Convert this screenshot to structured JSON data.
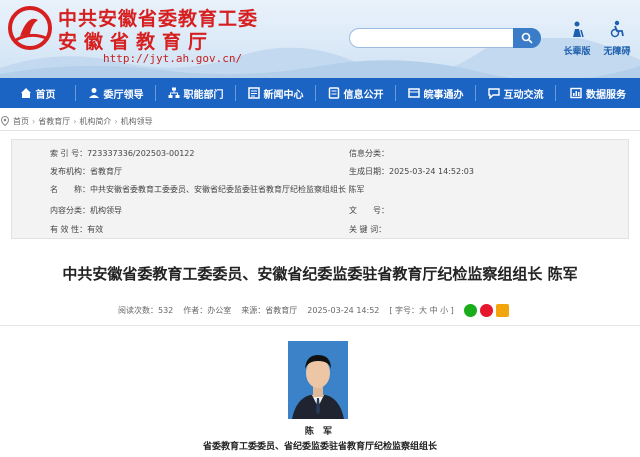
{
  "header": {
    "title_line1": "中共安徽省委教育工委",
    "title_line2": "安徽省教育厅",
    "url": "http://jyt.ah.gov.cn/",
    "search_placeholder": "",
    "tools": [
      {
        "label": "长辈版",
        "icon": "elder-icon"
      },
      {
        "label": "无障碍",
        "icon": "accessibility-icon"
      }
    ]
  },
  "nav": {
    "items": [
      {
        "label": "首页",
        "icon": "home-icon"
      },
      {
        "label": "委厅领导",
        "icon": "leader-icon"
      },
      {
        "label": "职能部门",
        "icon": "org-icon"
      },
      {
        "label": "新闻中心",
        "icon": "news-icon"
      },
      {
        "label": "信息公开",
        "icon": "info-icon"
      },
      {
        "label": "皖事通办",
        "icon": "service-icon"
      },
      {
        "label": "互动交流",
        "icon": "chat-icon"
      },
      {
        "label": "数据服务",
        "icon": "data-icon"
      }
    ]
  },
  "breadcrumb": [
    "首页",
    "省教育厅",
    "机构简介",
    "机构领导"
  ],
  "meta": {
    "index_label": "索 引 号：",
    "index_value": "723337336/202503-00122",
    "category_label": "信息分类：",
    "category_value": "",
    "publisher_label": "发布机构：",
    "publisher_value": "省教育厅",
    "date_label": "生成日期：",
    "date_value": "2025-03-24 14:52:03",
    "name_label": "名　　称：",
    "name_value": "中共安徽省委教育工委委员、安徽省纪委监委驻省教育厅纪检监察组组长 陈军",
    "content_label": "内容分类：",
    "content_value": "机构领导",
    "docno_label": "文　　号：",
    "docno_value": "",
    "validity_label": "有 效 性：",
    "validity_value": "有效",
    "keyword_label": "关 键 词：",
    "keyword_value": ""
  },
  "article": {
    "title": "中共安徽省委教育工委委员、安徽省纪委监委驻省教育厅纪检监察组组长 陈军",
    "views": "阅读次数：532",
    "author": "作者：办公室",
    "source": "来源：省教育厅",
    "date": "2025-03-24 14:52",
    "font_size": "[ 字号：大 中 小 ]",
    "share_colors": [
      "#1aad19",
      "#e6162d",
      "#f2a60c"
    ],
    "caption_name": "陈 军",
    "caption_role": "省委教育工委委员、省纪委监委驻省教育厅纪检监察组组长"
  },
  "colors": {
    "nav_bg": "#1b64c4",
    "title_red": "#d61f1f",
    "photo_bg": "#3b82c9"
  }
}
